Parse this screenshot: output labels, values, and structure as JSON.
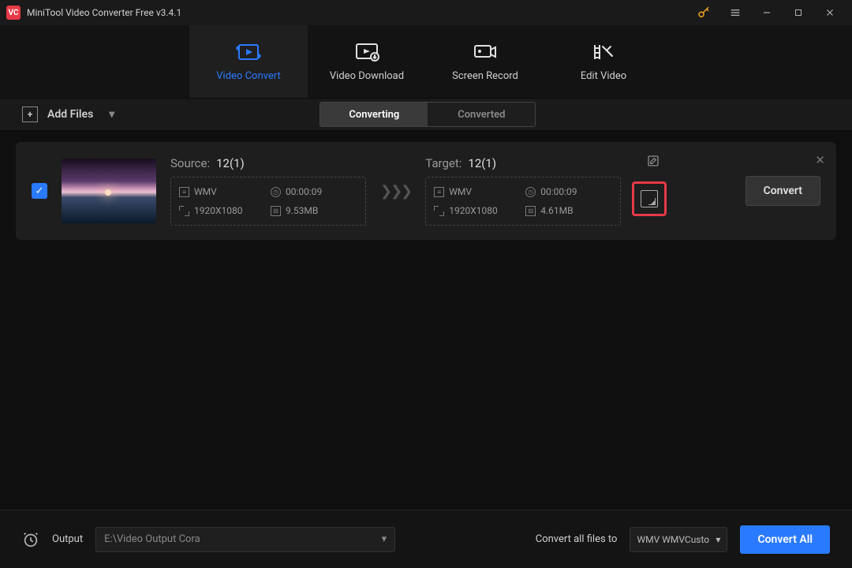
{
  "app": {
    "title": "MiniTool Video Converter Free v3.4.1"
  },
  "nav": {
    "tabs": [
      {
        "label": "Video Convert"
      },
      {
        "label": "Video Download"
      },
      {
        "label": "Screen Record"
      },
      {
        "label": "Edit Video"
      }
    ]
  },
  "toolbar": {
    "add_files_label": "Add Files",
    "seg_converting": "Converting",
    "seg_converted": "Converted"
  },
  "item": {
    "source_label": "Source:",
    "source_name": "12(1)",
    "source_format": "WMV",
    "source_duration": "00:00:09",
    "source_resolution": "1920X1080",
    "source_size": "9.53MB",
    "target_label": "Target:",
    "target_name": "12(1)",
    "target_format": "WMV",
    "target_duration": "00:00:09",
    "target_resolution": "1920X1080",
    "target_size": "4.61MB",
    "convert_label": "Convert"
  },
  "footer": {
    "output_label": "Output",
    "output_path": "E:\\Video Output Cora",
    "convert_all_to_label": "Convert all files to",
    "format_value": "WMV WMVCustom",
    "convert_all_label": "Convert All"
  }
}
